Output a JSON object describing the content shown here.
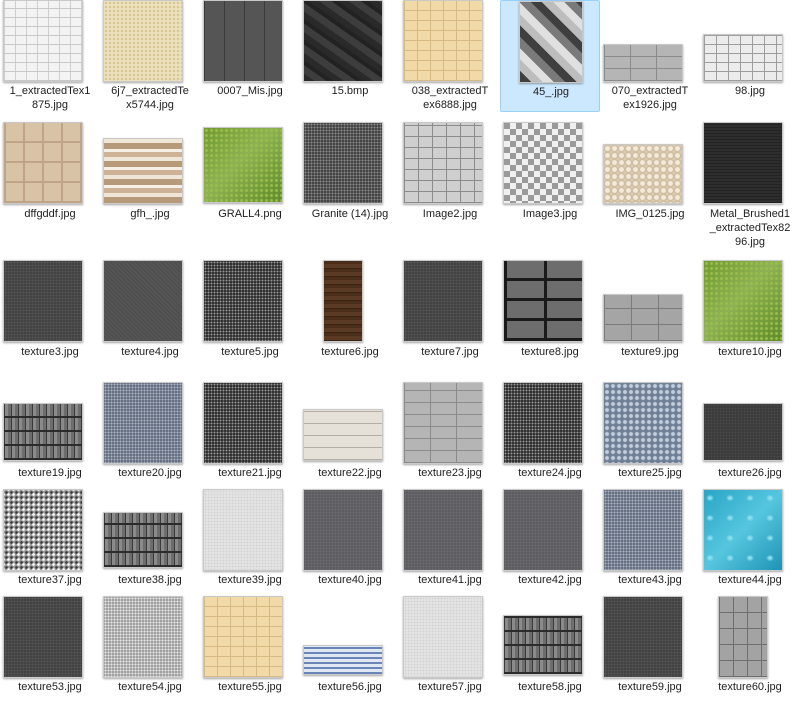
{
  "colors": {
    "selection_bg": "#cce8ff",
    "selection_border": "#99d1ff",
    "text": "#1e1e1e"
  },
  "rows": [
    {
      "items": [
        {
          "name": "1_extractedTex1875.jpg",
          "lines": [
            "1_extractedTex1",
            "875.jpg"
          ],
          "icon": "white-brick-texture",
          "selected": false
        },
        {
          "name": "6j7_extractedTex5744.jpg",
          "lines": [
            "6j7_extractedTe",
            "x5744.jpg"
          ],
          "icon": "sand-texture",
          "selected": false
        },
        {
          "name": "0007_Mis.jpg",
          "lines": [
            "0007_Mis.jpg"
          ],
          "icon": "dark-panel-texture",
          "selected": false
        },
        {
          "name": "15.bmp",
          "lines": [
            "15.bmp"
          ],
          "icon": "dark-slate-texture",
          "selected": false
        },
        {
          "name": "038_extractedTex6888.jpg",
          "lines": [
            "038_extractedT",
            "ex6888.jpg"
          ],
          "icon": "beige-tile-texture",
          "selected": false
        },
        {
          "name": "45_.jpg",
          "lines": [
            "45_.jpg"
          ],
          "icon": "herringbone-texture",
          "selected": true
        },
        {
          "name": "070_extractedTex1926.jpg",
          "lines": [
            "070_extractedT",
            "ex1926.jpg"
          ],
          "icon": "gray-brick-texture",
          "selected": false
        },
        {
          "name": "98.jpg",
          "lines": [
            "98.jpg"
          ],
          "icon": "white-paver-texture",
          "selected": false
        }
      ]
    },
    {
      "items": [
        {
          "name": "dffgddf.jpg",
          "lines": [
            "dffgddf.jpg"
          ],
          "icon": "beige-paving-texture",
          "selected": false
        },
        {
          "name": "gfh_.jpg",
          "lines": [
            "gfh_.jpg"
          ],
          "icon": "striped-wood-texture",
          "selected": false
        },
        {
          "name": "GRALL4.png",
          "lines": [
            "GRALL4.png"
          ],
          "icon": "grass-texture",
          "selected": false
        },
        {
          "name": "Granite (14).jpg",
          "lines": [
            "Granite (14).jpg"
          ],
          "icon": "granite-texture",
          "selected": false
        },
        {
          "name": "Image2.jpg",
          "lines": [
            "Image2.jpg"
          ],
          "icon": "stone-tile-texture",
          "selected": false
        },
        {
          "name": "Image3.jpg",
          "lines": [
            "Image3.jpg"
          ],
          "icon": "mosaic-texture",
          "selected": false
        },
        {
          "name": "IMG_0125.jpg",
          "lines": [
            "IMG_0125.jpg"
          ],
          "icon": "pebble-texture",
          "selected": false
        },
        {
          "name": "Metal_Brushed1_extractedTex8296.jpg",
          "lines": [
            "Metal_Brushed1",
            "_extractedTex82",
            "96.jpg"
          ],
          "icon": "brushed-metal-texture",
          "selected": false
        }
      ]
    },
    {
      "items": [
        {
          "name": "texture3.jpg",
          "lines": [
            "texture3.jpg"
          ],
          "icon": "asphalt-texture",
          "selected": false
        },
        {
          "name": "texture4.jpg",
          "lines": [
            "texture4.jpg"
          ],
          "icon": "dark-fabric-texture",
          "selected": false
        },
        {
          "name": "texture5.jpg",
          "lines": [
            "texture5.jpg"
          ],
          "icon": "speckled-texture",
          "selected": false
        },
        {
          "name": "texture6.jpg",
          "lines": [
            "texture6.jpg"
          ],
          "icon": "wood-plank-texture",
          "selected": false
        },
        {
          "name": "texture7.jpg",
          "lines": [
            "texture7.jpg"
          ],
          "icon": "asphalt-texture",
          "selected": false
        },
        {
          "name": "texture8.jpg",
          "lines": [
            "texture8.jpg"
          ],
          "icon": "dark-brick-texture",
          "selected": false
        },
        {
          "name": "texture9.jpg",
          "lines": [
            "texture9.jpg"
          ],
          "icon": "gray-block-texture",
          "selected": false
        },
        {
          "name": "texture10.jpg",
          "lines": [
            "texture10.jpg"
          ],
          "icon": "grass-texture",
          "selected": false
        }
      ]
    },
    {
      "items": [
        {
          "name": "texture19.jpg",
          "lines": [
            "texture19.jpg"
          ],
          "icon": "stone-wall-texture",
          "selected": false
        },
        {
          "name": "texture20.jpg",
          "lines": [
            "texture20.jpg"
          ],
          "icon": "blue-gravel-texture",
          "selected": false
        },
        {
          "name": "texture21.jpg",
          "lines": [
            "texture21.jpg"
          ],
          "icon": "speckled-texture",
          "selected": false
        },
        {
          "name": "texture22.jpg",
          "lines": [
            "texture22.jpg"
          ],
          "icon": "light-plank-texture",
          "selected": false
        },
        {
          "name": "texture23.jpg",
          "lines": [
            "texture23.jpg"
          ],
          "icon": "gray-brick-texture",
          "selected": false
        },
        {
          "name": "texture24.jpg",
          "lines": [
            "texture24.jpg"
          ],
          "icon": "speckled-texture",
          "selected": false
        },
        {
          "name": "texture25.jpg",
          "lines": [
            "texture25.jpg"
          ],
          "icon": "blue-stone-texture",
          "selected": false
        },
        {
          "name": "texture26.jpg",
          "lines": [
            "texture26.jpg"
          ],
          "icon": "dark-concrete-texture",
          "selected": false
        }
      ]
    },
    {
      "items": [
        {
          "name": "texture37.jpg",
          "lines": [
            "texture37.jpg"
          ],
          "icon": "terrazzo-texture",
          "selected": false
        },
        {
          "name": "texture38.jpg",
          "lines": [
            "texture38.jpg"
          ],
          "icon": "stone-wall-texture",
          "selected": false
        },
        {
          "name": "texture39.jpg",
          "lines": [
            "texture39.jpg"
          ],
          "icon": "light-plaster-texture",
          "selected": false
        },
        {
          "name": "texture40.jpg",
          "lines": [
            "texture40.jpg"
          ],
          "icon": "gray-concrete-texture",
          "selected": false
        },
        {
          "name": "texture41.jpg",
          "lines": [
            "texture41.jpg"
          ],
          "icon": "gray-concrete-texture",
          "selected": false
        },
        {
          "name": "texture42.jpg",
          "lines": [
            "texture42.jpg"
          ],
          "icon": "gray-concrete-texture",
          "selected": false
        },
        {
          "name": "texture43.jpg",
          "lines": [
            "texture43.jpg"
          ],
          "icon": "blue-gravel-texture",
          "selected": false
        },
        {
          "name": "texture44.jpg",
          "lines": [
            "texture44.jpg"
          ],
          "icon": "water-texture",
          "selected": false
        }
      ]
    },
    {
      "items": [
        {
          "name": "texture53.jpg",
          "lines": [
            "texture53.jpg"
          ],
          "icon": "asphalt-texture",
          "selected": false
        },
        {
          "name": "texture54.jpg",
          "lines": [
            "texture54.jpg"
          ],
          "icon": "light-gravel-texture",
          "selected": false
        },
        {
          "name": "texture55.jpg",
          "lines": [
            "texture55.jpg"
          ],
          "icon": "beige-tile-texture",
          "selected": false
        },
        {
          "name": "texture56.jpg",
          "lines": [
            "texture56.jpg"
          ],
          "icon": "blue-stripe-texture",
          "selected": false
        },
        {
          "name": "texture57.jpg",
          "lines": [
            "texture57.jpg"
          ],
          "icon": "light-plaster-texture",
          "selected": false
        },
        {
          "name": "texture58.jpg",
          "lines": [
            "texture58.jpg"
          ],
          "icon": "stone-wall-texture",
          "selected": false
        },
        {
          "name": "texture59.jpg",
          "lines": [
            "texture59.jpg"
          ],
          "icon": "asphalt-texture",
          "selected": false
        },
        {
          "name": "texture60.jpg",
          "lines": [
            "texture60.jpg"
          ],
          "icon": "gray-paver-texture",
          "selected": false
        }
      ]
    }
  ]
}
